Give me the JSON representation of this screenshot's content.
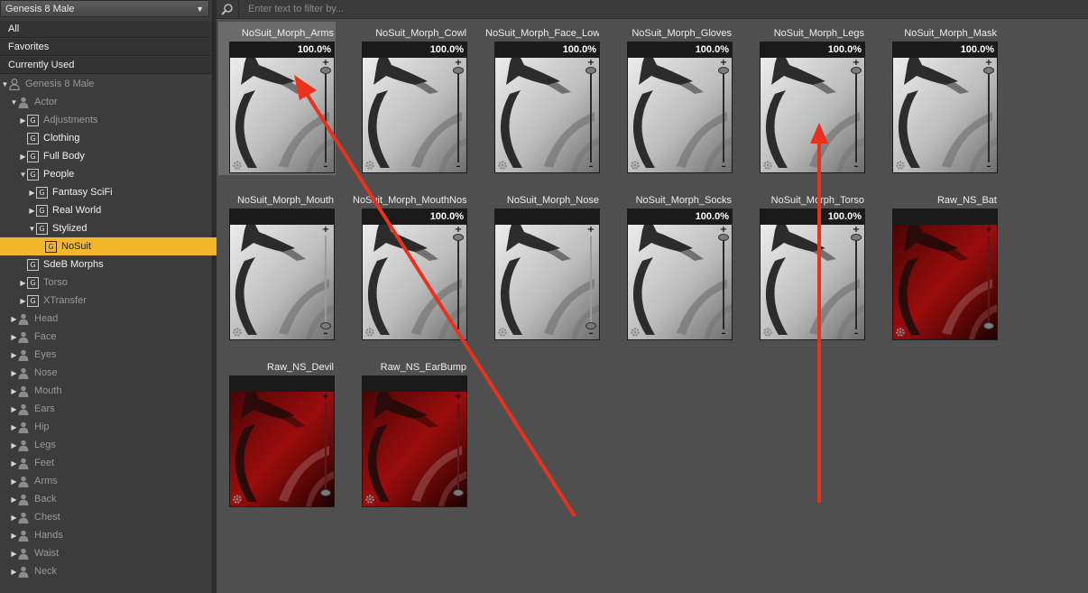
{
  "left_panel": {
    "figure_selector": {
      "value": "Genesis 8 Male"
    },
    "quick_filters": [
      "All",
      "Favorites",
      "Currently Used"
    ],
    "tree": [
      {
        "label": "Genesis 8 Male",
        "depth": 0,
        "expander": "open",
        "icon": "figure-icon",
        "enabled": false
      },
      {
        "label": "Actor",
        "depth": 1,
        "expander": "open",
        "icon": "person-icon",
        "enabled": false
      },
      {
        "label": "Adjustments",
        "depth": 2,
        "expander": "closed",
        "icon": "group-icon",
        "enabled": false
      },
      {
        "label": "Clothing",
        "depth": 2,
        "expander": "none",
        "icon": "group-icon",
        "enabled": true
      },
      {
        "label": "Full Body",
        "depth": 2,
        "expander": "closed",
        "icon": "group-icon",
        "enabled": true
      },
      {
        "label": "People",
        "depth": 2,
        "expander": "open",
        "icon": "group-icon",
        "enabled": true
      },
      {
        "label": "Fantasy SciFi",
        "depth": 3,
        "expander": "closed",
        "icon": "group-icon",
        "enabled": true
      },
      {
        "label": "Real World",
        "depth": 3,
        "expander": "closed",
        "icon": "group-icon",
        "enabled": true
      },
      {
        "label": "Stylized",
        "depth": 3,
        "expander": "open",
        "icon": "group-icon",
        "enabled": true
      },
      {
        "label": "NoSuit",
        "depth": 4,
        "expander": "none",
        "icon": "group-icon",
        "enabled": true,
        "selected": true
      },
      {
        "label": "SdeB Morphs",
        "depth": 2,
        "expander": "none",
        "icon": "group-icon",
        "enabled": true
      },
      {
        "label": "Torso",
        "depth": 2,
        "expander": "closed",
        "icon": "group-icon",
        "enabled": false
      },
      {
        "label": "XTransfer",
        "depth": 2,
        "expander": "closed",
        "icon": "group-icon",
        "enabled": false
      },
      {
        "label": "Head",
        "depth": 1,
        "expander": "closed",
        "icon": "person-icon",
        "enabled": false
      },
      {
        "label": "Face",
        "depth": 1,
        "expander": "closed",
        "icon": "person-icon",
        "enabled": false
      },
      {
        "label": "Eyes",
        "depth": 1,
        "expander": "closed",
        "icon": "person-icon",
        "enabled": false
      },
      {
        "label": "Nose",
        "depth": 1,
        "expander": "closed",
        "icon": "person-icon",
        "enabled": false
      },
      {
        "label": "Mouth",
        "depth": 1,
        "expander": "closed",
        "icon": "person-icon",
        "enabled": false
      },
      {
        "label": "Ears",
        "depth": 1,
        "expander": "closed",
        "icon": "person-icon",
        "enabled": false
      },
      {
        "label": "Hip",
        "depth": 1,
        "expander": "closed",
        "icon": "person-icon",
        "enabled": false
      },
      {
        "label": "Legs",
        "depth": 1,
        "expander": "closed",
        "icon": "person-icon",
        "enabled": false
      },
      {
        "label": "Feet",
        "depth": 1,
        "expander": "closed",
        "icon": "person-icon",
        "enabled": false
      },
      {
        "label": "Arms",
        "depth": 1,
        "expander": "closed",
        "icon": "person-icon",
        "enabled": false
      },
      {
        "label": "Back",
        "depth": 1,
        "expander": "closed",
        "icon": "person-icon",
        "enabled": false
      },
      {
        "label": "Chest",
        "depth": 1,
        "expander": "closed",
        "icon": "person-icon",
        "enabled": false
      },
      {
        "label": "Hands",
        "depth": 1,
        "expander": "closed",
        "icon": "person-icon",
        "enabled": false
      },
      {
        "label": "Waist",
        "depth": 1,
        "expander": "closed",
        "icon": "person-icon",
        "enabled": false
      },
      {
        "label": "Neck",
        "depth": 1,
        "expander": "closed",
        "icon": "person-icon",
        "enabled": false
      }
    ]
  },
  "content": {
    "filter": {
      "placeholder": "Enter text to filter by...",
      "value": ""
    },
    "tiles": [
      {
        "title": "NoSuit_Morph_Arms",
        "percent": "100.0%",
        "style": "gray",
        "value": 1.0,
        "active": true
      },
      {
        "title": "NoSuit_Morph_Cowl",
        "percent": "100.0%",
        "style": "gray",
        "value": 1.0
      },
      {
        "title": "NoSuit_Morph_Face_Low",
        "percent": "100.0%",
        "style": "gray",
        "value": 1.0
      },
      {
        "title": "NoSuit_Morph_Gloves",
        "percent": "100.0%",
        "style": "gray",
        "value": 1.0
      },
      {
        "title": "NoSuit_Morph_Legs",
        "percent": "100.0%",
        "style": "gray",
        "value": 1.0
      },
      {
        "title": "NoSuit_Morph_Mask",
        "percent": "100.0%",
        "style": "gray",
        "value": 1.0
      },
      {
        "title": "NoSuit_Morph_Mouth",
        "percent": "",
        "style": "gray",
        "value": 0.0
      },
      {
        "title": "NoSuit_Morph_MouthNose",
        "percent": "100.0%",
        "style": "gray",
        "value": 1.0
      },
      {
        "title": "NoSuit_Morph_Nose",
        "percent": "",
        "style": "gray",
        "value": 0.0
      },
      {
        "title": "NoSuit_Morph_Socks",
        "percent": "100.0%",
        "style": "gray",
        "value": 1.0
      },
      {
        "title": "NoSuit_Morph_Torso",
        "percent": "100.0%",
        "style": "gray",
        "value": 1.0
      },
      {
        "title": "Raw_NS_Bat",
        "percent": "",
        "style": "red",
        "value": 0.0
      },
      {
        "title": "Raw_NS_Devil",
        "percent": "",
        "style": "red",
        "value": 0.0
      },
      {
        "title": "Raw_NS_EarBump",
        "percent": "",
        "style": "red",
        "value": 0.0
      }
    ]
  },
  "colors": {
    "selection": "#f2b72a",
    "annotation_arrow": "#e8321e",
    "tile_red": "#8a0c0c"
  }
}
